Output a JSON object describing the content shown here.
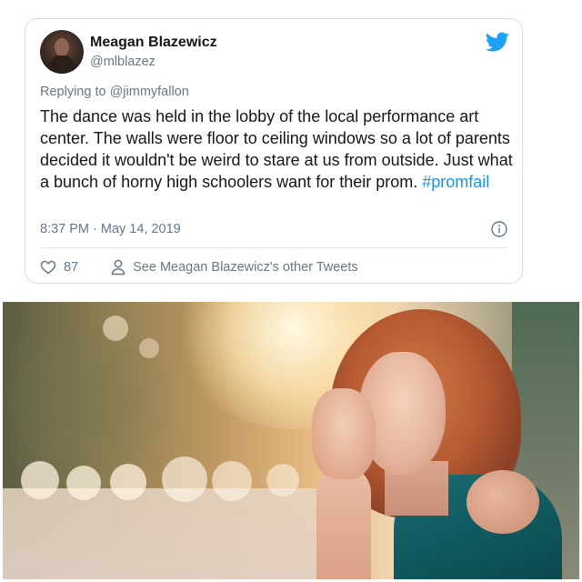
{
  "tweet": {
    "display_name": "Meagan Blazewicz",
    "handle": "@mlblazez",
    "replying_to_prefix": "Replying to ",
    "replying_to_handle": "@jimmyfallon",
    "text": "The dance was held in the lobby of the local performance art center. The walls were floor to ceiling windows so a lot of parents decided it wouldn't be weird to stare at us from outside. Just what a bunch of horny high schoolers want for their prom. ",
    "hashtag": "#promfail",
    "timestamp": "8:37 PM · May 14, 2019",
    "likes": "87",
    "other_tweets_link": "See Meagan Blazewicz's other Tweets"
  },
  "icons": {
    "brand": "twitter-bird-icon",
    "like": "heart-icon",
    "profile": "person-icon",
    "info": "info-icon"
  },
  "colors": {
    "text": "#14171a",
    "secondary": "#657786",
    "hashtag": "#1b95e0",
    "twitter_blue": "#1da1f2",
    "border": "#d7dde2"
  }
}
